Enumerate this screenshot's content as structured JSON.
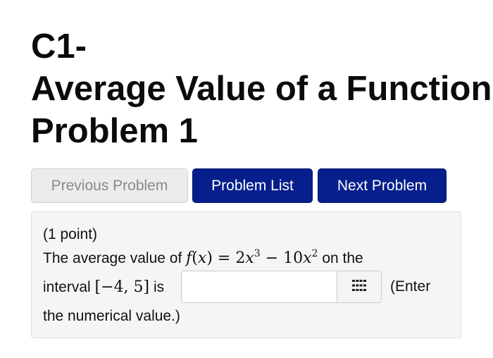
{
  "title": {
    "line1": "C1-",
    "line2": "Average Value of a Function",
    "line3": "Problem 1"
  },
  "nav": {
    "previous_label": "Previous Problem",
    "list_label": "Problem List",
    "next_label": "Next Problem"
  },
  "problem": {
    "points": "(1 point)",
    "text_before": "The average value of",
    "function": "f(x) = 2x³ − 10x²",
    "text_after": "on the",
    "interval_prefix": "interval",
    "interval": "[−4, 5]",
    "interval_suffix": "is",
    "enter_note_1": "(Enter",
    "enter_note_2": "the numerical value.)",
    "answer_value": "",
    "answer_placeholder": "",
    "palette_icon": "grid-icon"
  },
  "colors": {
    "primary_button": "#071f8c",
    "disabled_button": "#ececec",
    "panel_background": "#f5f5f5"
  }
}
